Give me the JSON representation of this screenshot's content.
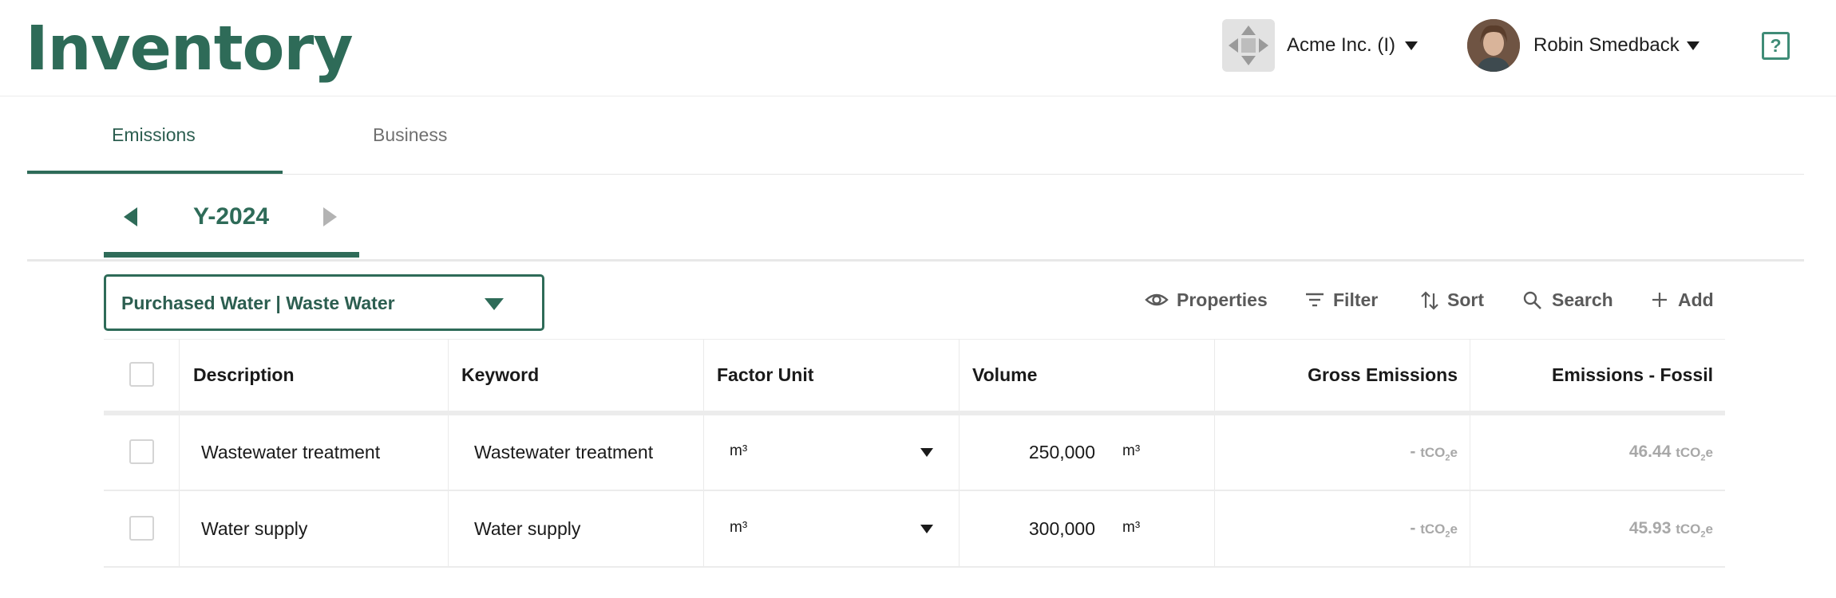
{
  "app": {
    "title": "Inventory",
    "organization": "Acme Inc. (I)",
    "user": "Robin Smedback",
    "help_label": "?"
  },
  "tabs": [
    {
      "label": "Emissions",
      "active": true
    },
    {
      "label": "Business",
      "active": false
    }
  ],
  "period": {
    "label": "Y-2024"
  },
  "category": {
    "selected": "Purchased Water | Waste Water"
  },
  "toolbar": {
    "properties": "Properties",
    "filter": "Filter",
    "sort": "Sort",
    "search": "Search",
    "add": "Add"
  },
  "table": {
    "headers": {
      "description": "Description",
      "keyword": "Keyword",
      "factor_unit": "Factor Unit",
      "volume": "Volume",
      "gross_emissions": "Gross Emissions",
      "emissions_fossil": "Emissions - Fossil"
    },
    "rows": [
      {
        "description": "Wastewater treatment",
        "keyword": "Wastewater treatment",
        "factor_unit": "m³",
        "volume": "250,000",
        "volume_unit": "m³",
        "gross_emissions": "-",
        "gross_unit": "tCO",
        "emissions_fossil": "46.44",
        "fossil_unit": "tCO"
      },
      {
        "description": "Water supply",
        "keyword": "Water supply",
        "factor_unit": "m³",
        "volume": "300,000",
        "volume_unit": "m³",
        "gross_emissions": "-",
        "gross_unit": "tCO",
        "emissions_fossil": "45.93",
        "fossil_unit": "tCO"
      }
    ]
  },
  "colors": {
    "brand": "#2e6b58",
    "muted_value": "#a8a8a8"
  }
}
